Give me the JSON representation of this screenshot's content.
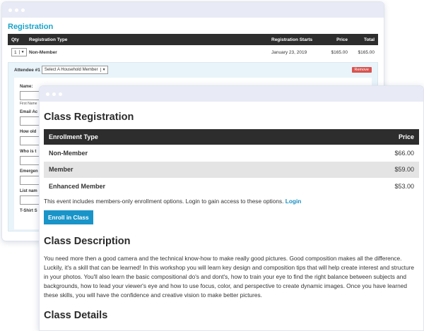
{
  "back": {
    "section_title": "Registration",
    "columns": {
      "qty": "Qty",
      "type": "Registration Type",
      "starts": "Registration Starts",
      "price": "Price",
      "total": "Total"
    },
    "row": {
      "qty": "1",
      "type": "Non-Member",
      "starts": "January 23, 2019",
      "price": "$165.00",
      "total": "$165.00"
    },
    "attendee_label": "Attendee #1",
    "household_select": "Select A Household Member",
    "remove_label": "Remove",
    "fields": {
      "name": "Name:",
      "first_name": "First Name",
      "email": "Email Ac",
      "how_old": "How old",
      "who_is": "Who is t",
      "emergency": "Emergen",
      "list_name": "List nam",
      "tshirt": "T-Shirt S"
    }
  },
  "front": {
    "title": "Class Registration",
    "table": {
      "col_type": "Enrollment Type",
      "col_price": "Price",
      "rows": [
        {
          "type": "Non-Member",
          "price": "$66.00"
        },
        {
          "type": "Member",
          "price": "$59.00"
        },
        {
          "type": "Enhanced Member",
          "price": "$53.00"
        }
      ]
    },
    "notice_text": "This event includes members-only enrollment options. Login to gain access to these options.",
    "login_link": "Login",
    "enroll_button": "Enroll in Class",
    "description_title": "Class Description",
    "description": "You need more then a good camera and the technical know-how to make really good pictures. Good composition makes all the difference. Luckily, it's a skill that can be learned! In this workshop you will learn key design and composition tips that will help create interest and structure in your photos. You'll also learn the basic compositional do's and dont's, how to train your eye to find the right balance between subjects and backgrounds, how to lead your viewer's eye and how to use focus, color, and perspective to create dynamic images. Once you have learned these skills, you will have the confidence and creative vision to make better pictures.",
    "details_title": "Class Details"
  },
  "colors": {
    "accent": "#1aa3c9",
    "button": "#1994c8",
    "header_bg": "#2d2d2d",
    "remove": "#d9534f"
  }
}
